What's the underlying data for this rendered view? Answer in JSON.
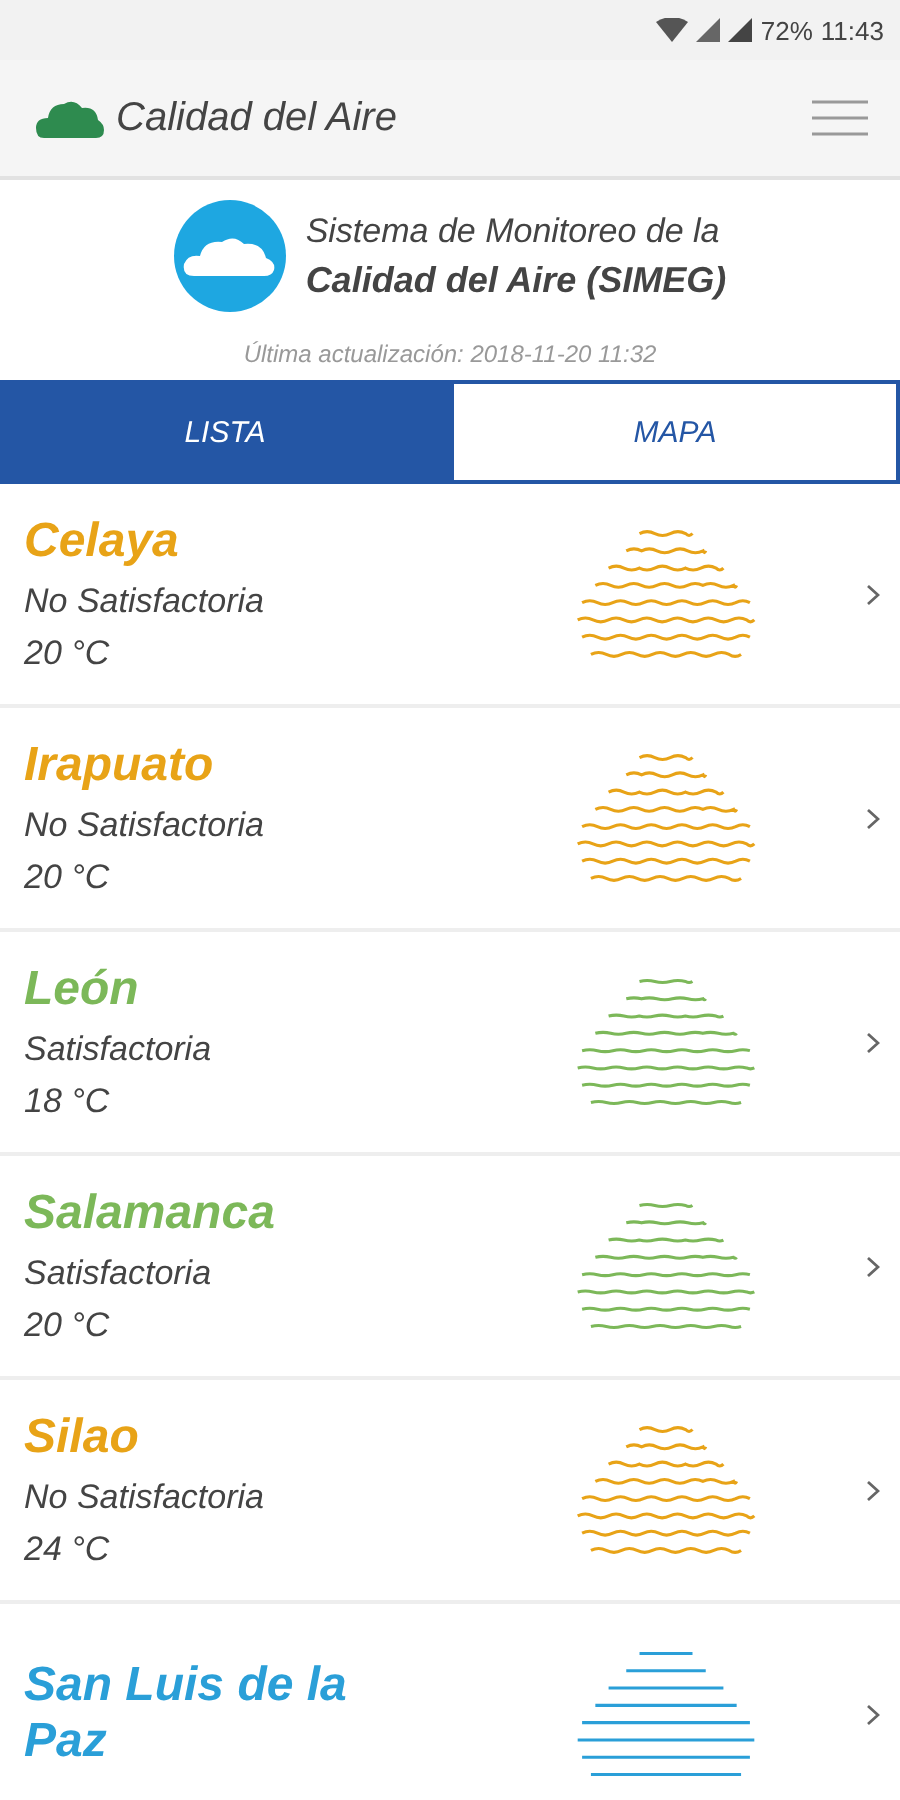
{
  "status_bar": {
    "battery": "72%",
    "time": "11:43"
  },
  "app_bar": {
    "title": "Calidad del Aire"
  },
  "header": {
    "line1": "Sistema de Monitoreo de la",
    "line2": "Calidad del Aire (SIMEG)",
    "updated": "Última actualización: 2018-11-20 11:32"
  },
  "tabs": [
    {
      "label": "LISTA",
      "selected": true
    },
    {
      "label": "MAPA",
      "selected": false
    }
  ],
  "stations": [
    {
      "name": "Celaya",
      "status": "No Satisfactoria",
      "temp": "20 °C",
      "color": "#e8a317",
      "kind": "wavy"
    },
    {
      "name": "Irapuato",
      "status": "No Satisfactoria",
      "temp": "20 °C",
      "color": "#e8a317",
      "kind": "wavy"
    },
    {
      "name": "León",
      "status": "Satisfactoria",
      "temp": "18 °C",
      "color": "#7cb859",
      "kind": "gentle"
    },
    {
      "name": "Salamanca",
      "status": "Satisfactoria",
      "temp": "20 °C",
      "color": "#7cb859",
      "kind": "gentle"
    },
    {
      "name": "Silao",
      "status": "No Satisfactoria",
      "temp": "24 °C",
      "color": "#e8a317",
      "kind": "wavy"
    },
    {
      "name": "San Luis de la Paz",
      "color": "#2a9fd8",
      "kind": "flat"
    }
  ]
}
